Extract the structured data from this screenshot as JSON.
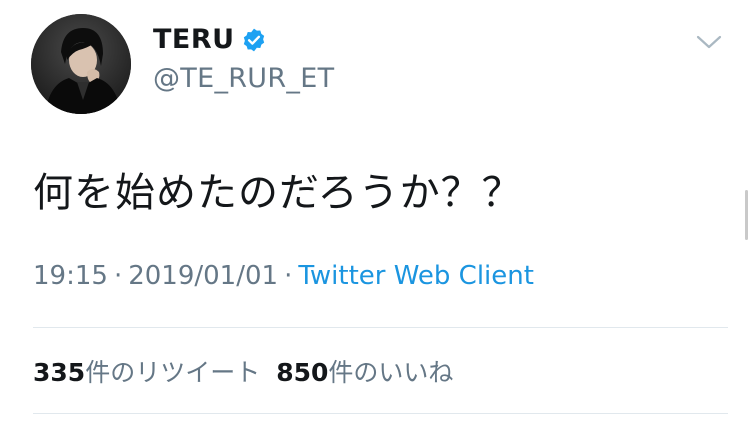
{
  "user": {
    "display_name": "TERU",
    "handle": "@TE_RUR_ET",
    "verified_icon": "verified-badge-icon"
  },
  "tweet": {
    "text": "何を始めたのだろうか？？",
    "time": "19:15",
    "date": "2019/01/01",
    "separator": "·",
    "client": "Twitter Web Client"
  },
  "stats": {
    "retweets_count": "335",
    "retweets_label": "件のリツイート",
    "likes_count": "850",
    "likes_label": "件のいいね"
  },
  "colors": {
    "accent": "#1b95e0",
    "secondary_text": "#657786",
    "primary_text": "#14171a",
    "divider": "#e1e8ed"
  }
}
